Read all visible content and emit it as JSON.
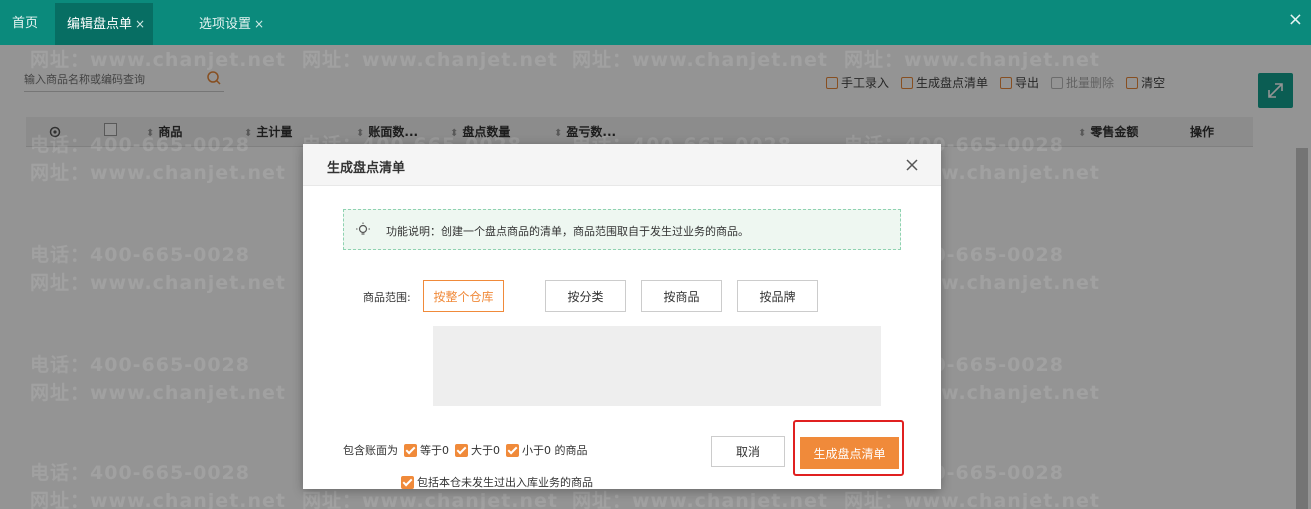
{
  "tabs": [
    {
      "label": "首页",
      "closable": false,
      "active": false
    },
    {
      "label": "编辑盘点单",
      "closable": true,
      "active": true
    },
    {
      "label": "选项设置",
      "closable": true,
      "active": false
    }
  ],
  "close_glyph": "×",
  "search": {
    "placeholder": "输入商品名称或编码查询"
  },
  "toolbar": {
    "manual_entry": "手工录入",
    "generate_list": "生成盘点清单",
    "export": "导出",
    "batch_delete": "批量删除",
    "clear": "清空"
  },
  "grid": {
    "columns": [
      "商品",
      "主计量",
      "账面数...",
      "盘点数量",
      "盈亏数...",
      "零售金额",
      "操作"
    ]
  },
  "watermark": {
    "phone": "电话：400-665-0028",
    "website": "网址：www.chanjet.net"
  },
  "dialog": {
    "title": "生成盘点清单",
    "info": "功能说明：创建一个盘点商品的清单，商品范围取自于发生过业务的商品。",
    "range_label": "商品范围:",
    "range_options": [
      "按整个仓库",
      "按分类",
      "按商品",
      "按品牌"
    ],
    "range_selected": "按整个仓库",
    "include_label": "包含账面为",
    "include_options": [
      "等于0",
      "大于0",
      "小于0 的商品"
    ],
    "include_unused": "包括本仓未发生过出入库业务的商品",
    "cancel": "取消",
    "confirm": "生成盘点清单"
  },
  "colors": {
    "topbar": "#0b8a7c",
    "accent": "#f08a3a",
    "highlight": "#e02020"
  }
}
